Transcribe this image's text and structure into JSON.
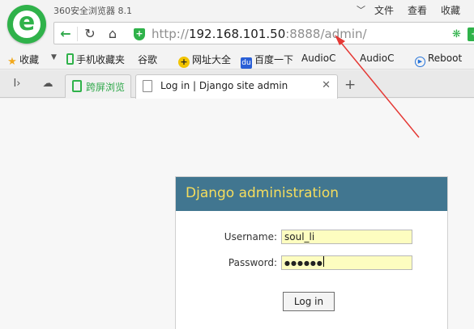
{
  "browser": {
    "app_title": "360安全浏览器 8.1",
    "menu": [
      "文件",
      "查看",
      "收藏"
    ]
  },
  "address_bar": {
    "protocol": "http://",
    "host": "192.168.101.50",
    "rest": ":8888/admin/"
  },
  "bookmarks": {
    "favorites_label": "收藏",
    "items": [
      "手机收藏夹",
      "谷歌",
      "网址大全",
      "百度一下",
      "AudioC",
      "AudioC",
      "Reboot"
    ]
  },
  "tabs": [
    {
      "label": "跨屏浏览"
    },
    {
      "label": "Log in | Django site admin"
    }
  ],
  "login": {
    "header": "Django administration",
    "username_label": "Username:",
    "username_value": "soul_li",
    "password_label": "Password:",
    "password_mask": "●●●●●●",
    "submit_label": "Log in"
  },
  "colors": {
    "brand_green": "#2fb24a",
    "django_header": "#417690",
    "django_header_text": "#f5dd5d",
    "annotation_arrow": "#e53935"
  }
}
